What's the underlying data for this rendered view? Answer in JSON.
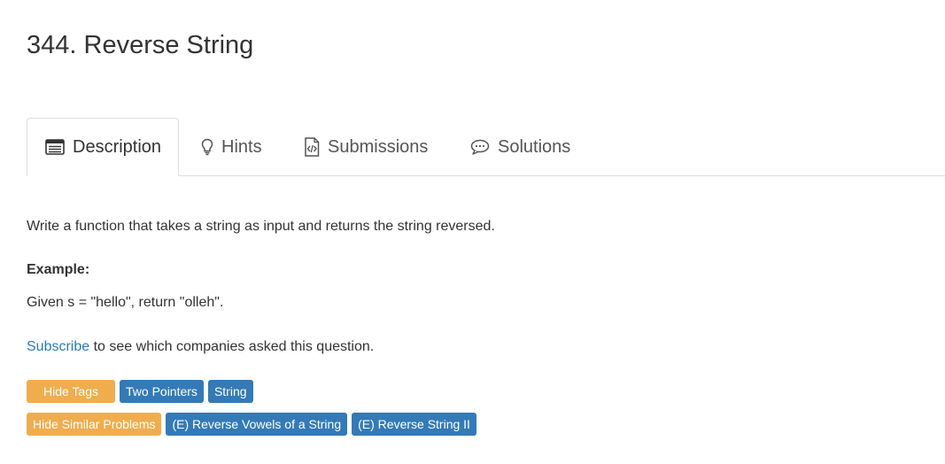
{
  "problem": {
    "title": "344. Reverse String"
  },
  "tabs": [
    {
      "label": "Description",
      "icon": "list-icon",
      "active": true
    },
    {
      "label": "Hints",
      "icon": "lightbulb-icon"
    },
    {
      "label": "Submissions",
      "icon": "code-file-icon"
    },
    {
      "label": "Solutions",
      "icon": "chat-bubble-icon"
    }
  ],
  "description": {
    "text": "Write a function that takes a string as input and returns the string reversed.",
    "example_label": "Example:",
    "example_text": "Given s = \"hello\", return \"olleh\"."
  },
  "subscribe": {
    "link_text": "Subscribe",
    "rest_text": " to see which companies asked this question."
  },
  "tags": {
    "toggle_label": "Hide Tags",
    "items": [
      "Two Pointers",
      "String"
    ]
  },
  "similar": {
    "toggle_label": "Hide Similar Problems",
    "items": [
      "(E) Reverse Vowels of a String",
      "(E) Reverse String II"
    ]
  },
  "colors": {
    "link": "#2a7ab8",
    "orange_button": "#f0ad4e",
    "blue_button": "#337ab7"
  }
}
